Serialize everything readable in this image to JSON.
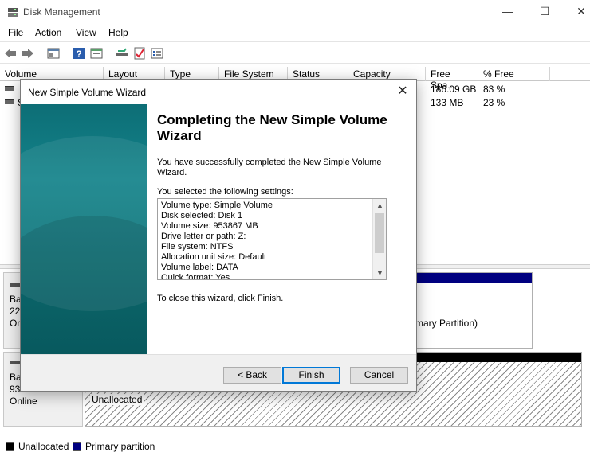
{
  "window": {
    "title": "Disk Management",
    "controls": {
      "minimize": "—",
      "maximize": "☐",
      "close": "✕"
    }
  },
  "menu": {
    "items": [
      "File",
      "Action",
      "View",
      "Help"
    ]
  },
  "volume_list": {
    "columns": [
      "Volume",
      "Layout",
      "Type",
      "File System",
      "Status",
      "Capacity",
      "Free Spa...",
      "% Free"
    ],
    "rows": [
      {
        "volume": "",
        "free_space": "186.09 GB",
        "pct_free": "83 %"
      },
      {
        "volume": "S",
        "free_space": "133 MB",
        "pct_free": "23 %"
      }
    ]
  },
  "disk_map": {
    "disk1": {
      "line1": "Ba",
      "line2": "22",
      "line3": "On",
      "partition_text": "mary Partition)"
    },
    "disk2": {
      "line1": "Ba",
      "line2": "93",
      "line3": "Online",
      "partition_label": "Unallocated"
    }
  },
  "legend": {
    "unallocated": "Unallocated",
    "primary": "Primary partition"
  },
  "colors": {
    "primary_partition": "#000080",
    "unallocated": "#000000",
    "wizard_banner": "#0d6e76",
    "focus": "#0078d7"
  },
  "wizard": {
    "title": "New Simple Volume Wizard",
    "close_icon": "✕",
    "heading": "Completing the New Simple Volume Wizard",
    "success_text": "You have successfully completed the New Simple Volume Wizard.",
    "settings_label": "You selected the following settings:",
    "settings": [
      "Volume type: Simple Volume",
      "Disk selected: Disk 1",
      "Volume size: 953867 MB",
      "Drive letter or path: Z:",
      "File system: NTFS",
      "Allocation unit size: Default",
      "Volume label: DATA",
      "Quick format: Yes"
    ],
    "close_hint": "To close this wizard, click Finish.",
    "buttons": {
      "back": "< Back",
      "finish": "Finish",
      "cancel": "Cancel"
    }
  }
}
